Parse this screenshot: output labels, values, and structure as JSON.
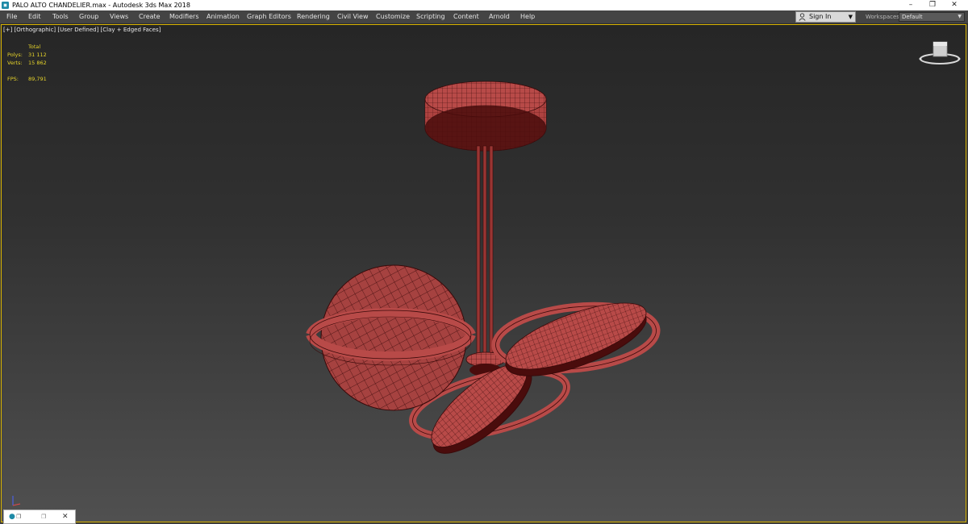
{
  "window": {
    "title": "PALO ALTO CHANDELIER.max - Autodesk 3ds Max 2018",
    "minimize_icon": "minimize-icon",
    "restore_icon": "restore-icon",
    "close_icon": "close-icon"
  },
  "menu": {
    "items": [
      "File",
      "Edit",
      "Tools",
      "Group",
      "Views",
      "Create",
      "Modifiers",
      "Animation",
      "Graph Editors",
      "Rendering",
      "Civil View",
      "Customize",
      "Scripting",
      "Content",
      "Arnold",
      "Help"
    ]
  },
  "account": {
    "signin_label": "Sign In",
    "icon": "user-icon"
  },
  "workspaces": {
    "label": "Workspaces:",
    "selected": "Default"
  },
  "viewport": {
    "label": "[+] [Orthographic] [User Defined] [Clay + Edged Faces]",
    "stats": {
      "total_label": "Total",
      "polys_label": "Polys:",
      "polys_value": "31 112",
      "verts_label": "Verts:",
      "verts_value": "15 862",
      "fps_label": "FPS:",
      "fps_value": "89,791"
    },
    "model_color": "#b84a48",
    "wire_color": "#3a0a0a",
    "border_color": "#d9b400"
  }
}
